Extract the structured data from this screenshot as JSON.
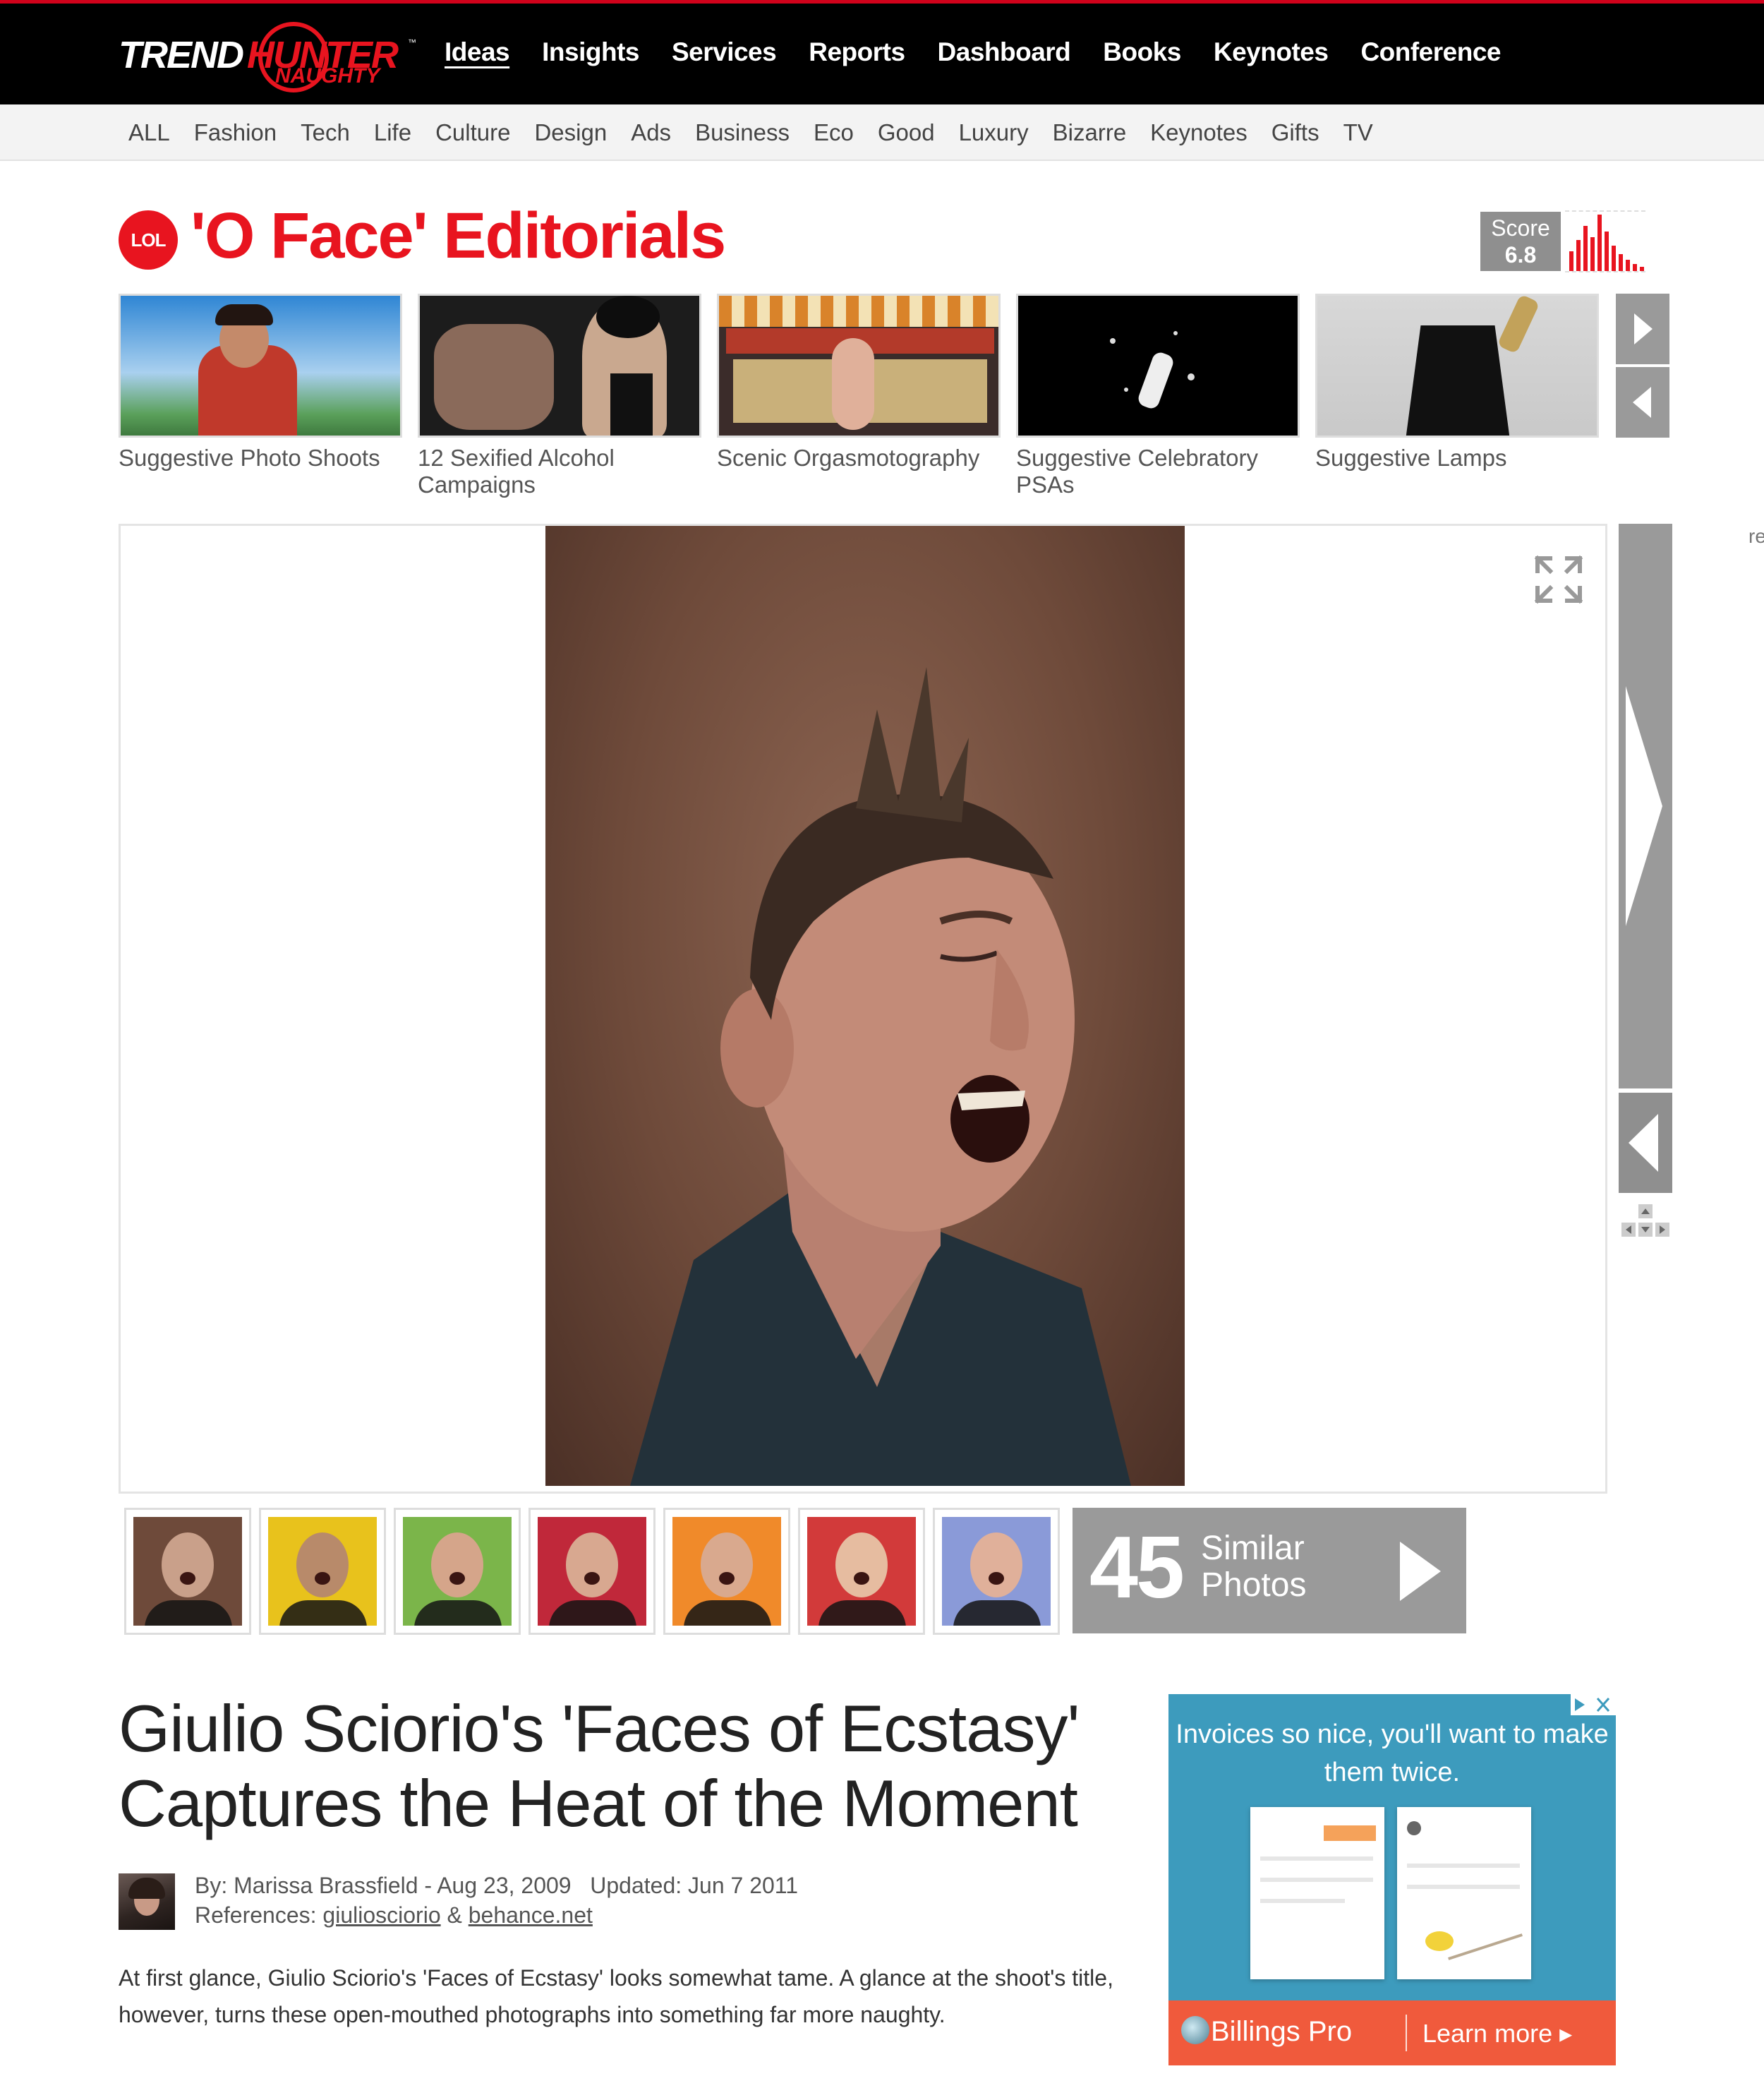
{
  "logo": {
    "part1": "TREND",
    "part2": "HUNTER",
    "sub": "NAUGHTY",
    "tm": "™"
  },
  "main_nav": [
    "Ideas",
    "Insights",
    "Services",
    "Reports",
    "Dashboard",
    "Books",
    "Keynotes",
    "Conference"
  ],
  "category_nav": [
    "ALL",
    "Fashion",
    "Tech",
    "Life",
    "Culture",
    "Design",
    "Ads",
    "Business",
    "Eco",
    "Good",
    "Luxury",
    "Bizarre",
    "Keynotes",
    "Gifts",
    "TV"
  ],
  "badge": "LOL",
  "title": "'O Face' Editorials",
  "score": {
    "label": "Score",
    "value": "6.8",
    "bars": [
      0.35,
      0.55,
      0.8,
      0.6,
      1.0,
      0.7,
      0.45,
      0.3,
      0.2,
      0.12,
      0.08
    ]
  },
  "related": [
    {
      "label": "Suggestive Photo Shoots",
      "colors": [
        "#2f86d4",
        "#a9d0ef",
        "#c0392b"
      ]
    },
    {
      "label": "12 Sexified Alcohol Campaigns",
      "colors": [
        "#1c1c1c",
        "#c9a88f",
        "#6a4a3a"
      ]
    },
    {
      "label": "Scenic Orgasmotography",
      "colors": [
        "#d9832a",
        "#b33a2a",
        "#3b2c2a"
      ]
    },
    {
      "label": "Suggestive Celebratory PSAs",
      "colors": [
        "#000000",
        "#111111",
        "#e8e8e8"
      ]
    },
    {
      "label": "Suggestive Lamps",
      "colors": [
        "#cfcfcf",
        "#d8d8d8",
        "#111111"
      ]
    }
  ],
  "similar": {
    "count": "45",
    "label_line1": "Similar",
    "label_line2": "Photos",
    "thumbs": [
      {
        "bg": "#6e4a3a",
        "skin": "#c9a08a"
      },
      {
        "bg": "#e8c21c",
        "skin": "#b88a6a"
      },
      {
        "bg": "#7bb54a",
        "skin": "#d5a58a"
      },
      {
        "bg": "#c0283a",
        "skin": "#d8a890"
      },
      {
        "bg": "#f08a2a",
        "skin": "#d9a98e"
      },
      {
        "bg": "#d23a3a",
        "skin": "#e6bca0"
      },
      {
        "bg": "#8a9ad8",
        "skin": "#e0b09a"
      }
    ]
  },
  "article": {
    "headline": "Giulio Sciorio's 'Faces of Ecstasy' Captures the Heat of the Moment",
    "byline": "By: Marissa Brassfield - Aug 23, 2009   Updated: Jun 7 2011",
    "references_label": "References:",
    "ref1": "giuliosciorio",
    "ref_sep": "&",
    "ref2": "behance.net",
    "body": "At first glance, Giulio Sciorio's 'Faces of Ecstasy' looks somewhat tame. A glance at the shoot's title, however, turns these open-mouthed photographs into something far more naughty."
  },
  "ad": {
    "headline": "Invoices so nice, you'll want to make them twice.",
    "brand": "Billings Pro",
    "cta": "Learn more ▸"
  },
  "edge_text": "re",
  "colors": {
    "brand_red": "#e8141f",
    "nav_bg": "#000000",
    "control_gray": "#9a9a9a",
    "ad_blue": "#3d9bbd",
    "ad_orange": "#f05a3c"
  },
  "icons": [
    "expand-icon",
    "next-arrow-icon",
    "prev-arrow-icon",
    "keyboard-arrows-icon",
    "play-icon"
  ]
}
